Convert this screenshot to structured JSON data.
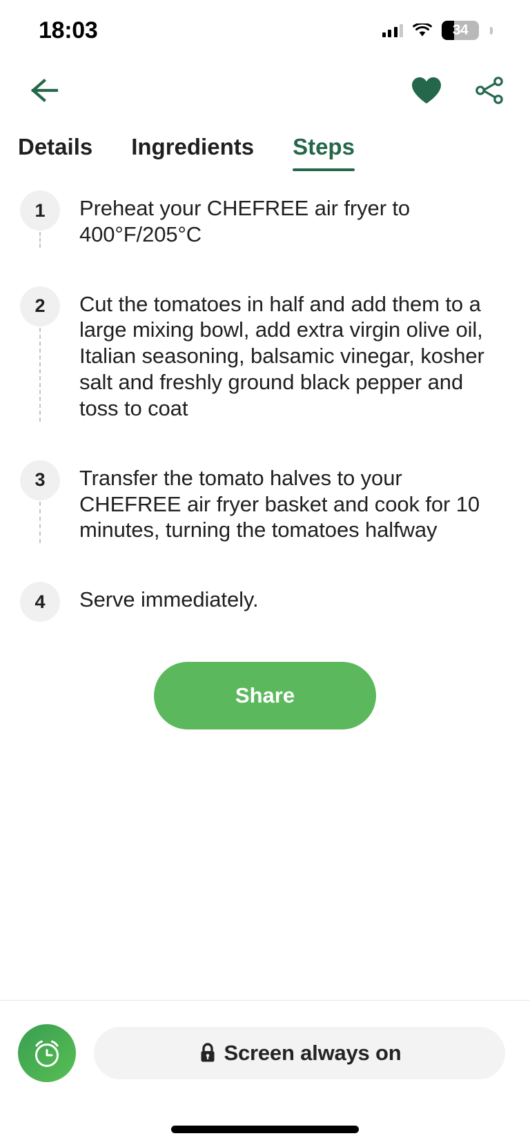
{
  "status_bar": {
    "time": "18:03",
    "battery_percent": "34",
    "battery_level": 34,
    "icons": [
      "cellular-signal-icon",
      "wifi-icon",
      "battery-icon"
    ]
  },
  "nav_bar": {
    "back_label": "back-arrow-icon",
    "favorite_label": "heart-icon",
    "share_label": "share-nodes-icon",
    "accent_color": "#25674a"
  },
  "tabs": {
    "items": [
      {
        "label": "Details",
        "active": false
      },
      {
        "label": "Ingredients",
        "active": false
      },
      {
        "label": "Steps",
        "active": true
      }
    ],
    "active_color": "#25674a",
    "inactive_color": "#1f1f1f"
  },
  "steps": {
    "items": [
      {
        "number": "1",
        "text": "Preheat your CHEFREE air fryer to 400°F/205°C"
      },
      {
        "number": "2",
        "text": "Cut the tomatoes in half and add them to a large mixing bowl, add extra virgin olive oil, Italian seasoning, balsamic vinegar, kosher salt and freshly ground black pepper and toss to coat"
      },
      {
        "number": "3",
        "text": "Transfer the tomato halves to your CHEFREE air fryer basket and cook for 10 minutes, turning the tomatoes halfway"
      },
      {
        "number": "4",
        "text": "Serve immediately."
      }
    ],
    "circle_color": "#f0f0f0",
    "connector_color": "#c4c4c4"
  },
  "share_button": {
    "label": "Share",
    "color": "#5cb85c",
    "text_color": "#ffffff"
  },
  "bottom_bar": {
    "alarm_button": "alarm-clock-icon",
    "screen_toggle": {
      "label": "Screen always on",
      "icon": "lock-icon"
    },
    "pill_color": "#f3f3f3"
  }
}
